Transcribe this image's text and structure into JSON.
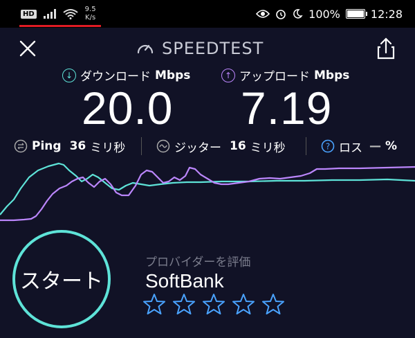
{
  "status_bar": {
    "hd": "HD",
    "net_speed_value": "9.5",
    "net_speed_unit": "K/s",
    "battery": "100%",
    "battery_level": 1.0,
    "time": "12:28"
  },
  "header": {
    "title": "SPEEDTEST",
    "icons": [
      "close-icon",
      "speedometer-icon",
      "share-icon"
    ]
  },
  "download": {
    "label": "ダウンロード",
    "unit": "Mbps",
    "value": "20.0",
    "color": "#5ee3d8"
  },
  "upload": {
    "label": "アップロード",
    "unit": "Mbps",
    "value": "7.19",
    "color": "#bb86fc"
  },
  "stats": {
    "ping": {
      "label": "Ping",
      "value": "36",
      "unit": "ミリ秒"
    },
    "jitter": {
      "label": "ジッター",
      "value": "16",
      "unit": "ミリ秒"
    },
    "loss": {
      "label": "ロス",
      "value": "—",
      "unit": "%",
      "icon_color": "#4aa3ff"
    }
  },
  "start_button": {
    "label": "スタート",
    "color": "#5ee3d8"
  },
  "provider": {
    "label": "プロバイダーを評価",
    "name": "SoftBank",
    "rating": 0,
    "max_rating": 5,
    "star_color": "#4aa3ff"
  }
}
